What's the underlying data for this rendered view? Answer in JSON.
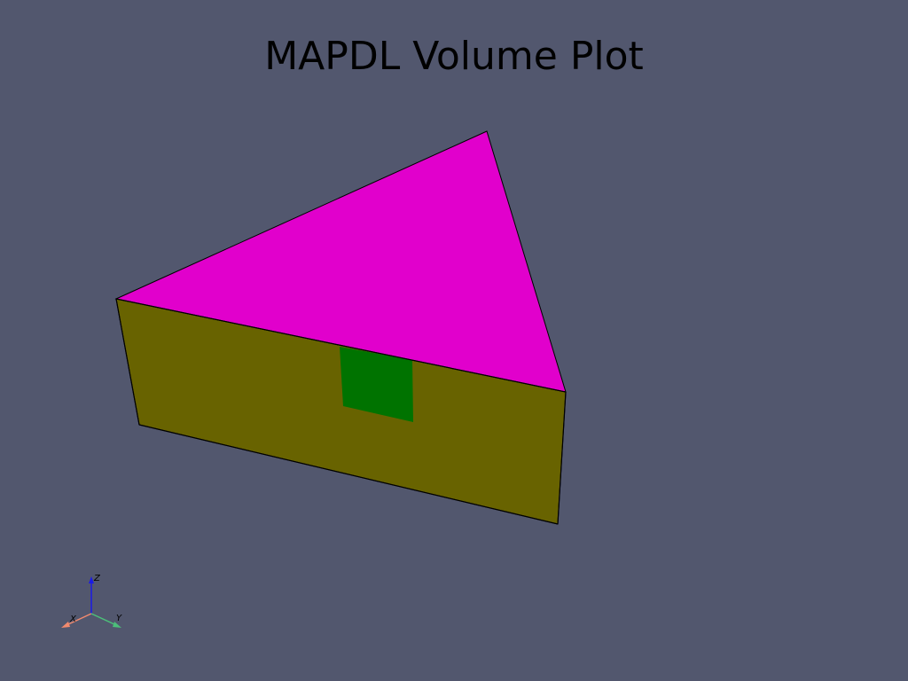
{
  "plot": {
    "title": "MAPDL Volume Plot"
  },
  "colors": {
    "background": "#52576e",
    "top_face": "#e100cc",
    "side_face": "#686300",
    "inner_face": "#007300",
    "edge": "#000000",
    "axis_x": "#f28a6e",
    "axis_y": "#4cbf7a",
    "axis_z": "#1a1ae6"
  },
  "axes_widget": {
    "x_label": "X",
    "y_label": "Y",
    "z_label": "Z"
  }
}
